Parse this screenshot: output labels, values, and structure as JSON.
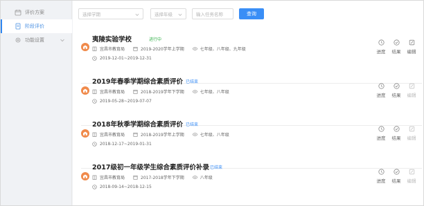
{
  "sidebar": {
    "items": [
      {
        "label": "评价方案",
        "icon": "calendar-icon"
      },
      {
        "label": "阶段评价",
        "icon": "document-icon"
      },
      {
        "label": "功能设置",
        "icon": "gear-icon"
      }
    ]
  },
  "filters": {
    "semester_placeholder": "选择学期",
    "grade_placeholder": "选择年级",
    "task_placeholder": "输入任务名称",
    "query_label": "查询"
  },
  "cards": [
    {
      "title": "夷陵实验学校",
      "status": "进行中",
      "status_color": "#37b24d",
      "org": "宜昌市教育局",
      "semester": "2019-2020学年上学期",
      "grades": "七年级、八年级、九年级",
      "dates": "2019-12-01~2019-12-31"
    },
    {
      "title": "2019年春季学期综合素质评价",
      "status": "已结束",
      "status_color": "#3a8ef6",
      "org": "宜昌市教育局",
      "semester": "2018-2019学年下学期",
      "grades": "七年级、八年级",
      "dates": "2019-05-28~2019-07-07"
    },
    {
      "title": "2018年秋季学期综合素质评价",
      "status": "已结束",
      "status_color": "#3a8ef6",
      "org": "宜昌市教育局",
      "semester": "2018-2019学年上学期",
      "grades": "七年级、八年级",
      "dates": "2018-12-17~2019-01-31"
    },
    {
      "title": "2017级初一年级学生综合素质评价补录",
      "status": "已结束",
      "status_color": "#3a8ef6",
      "org": "宜昌市教育局",
      "semester": "2017-2018学年下学期",
      "grades": "八年级",
      "dates": "2018-09-14~2018-12-15"
    }
  ],
  "actions": {
    "progress": "进度",
    "results": "结果",
    "edit": "编辑"
  }
}
